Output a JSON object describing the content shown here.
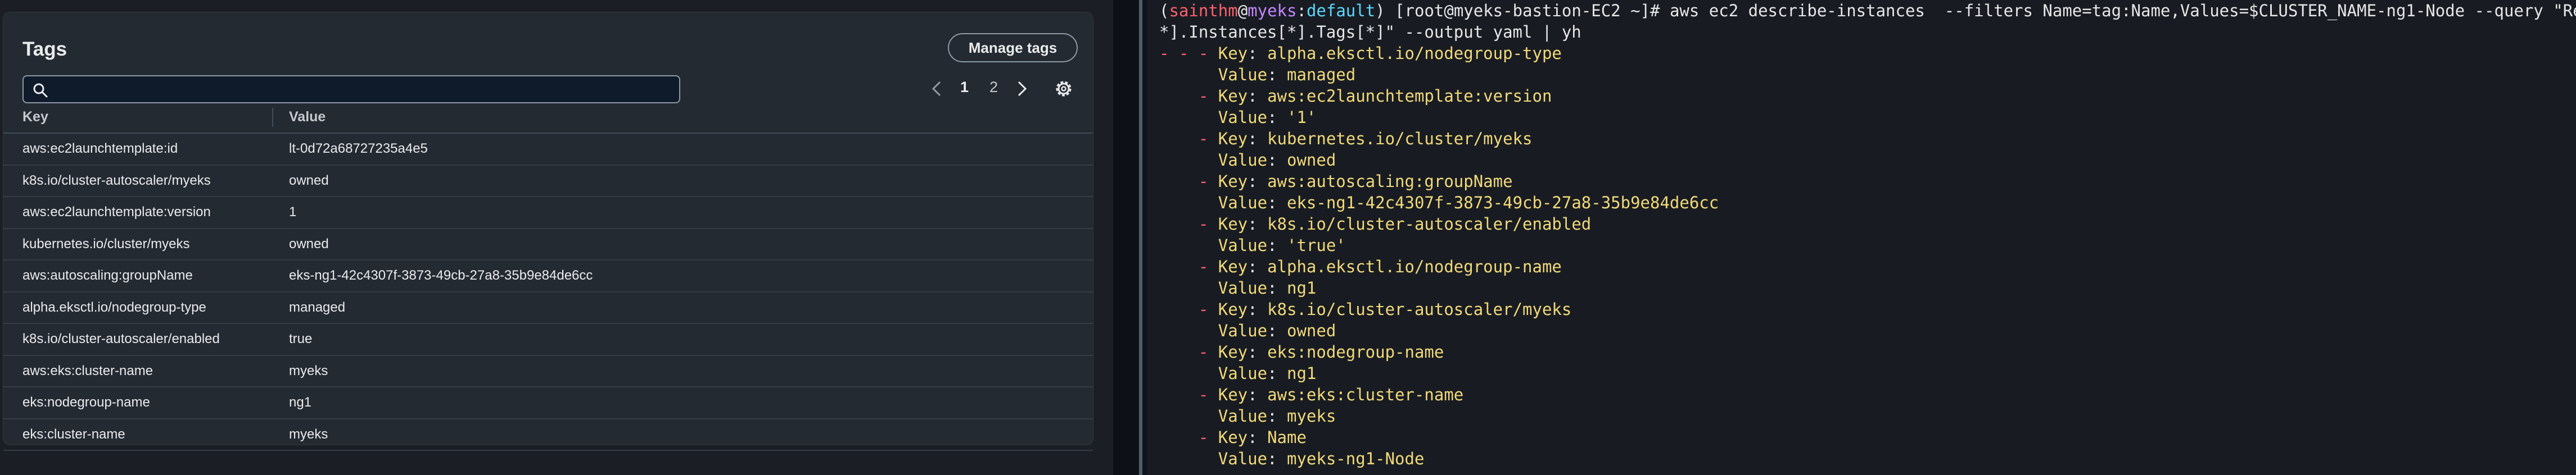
{
  "console": {
    "title": "Tags",
    "manage_button": "Manage tags",
    "search": {
      "placeholder": "",
      "value": ""
    },
    "pagination": {
      "pages": [
        "1",
        "2"
      ],
      "current": "1"
    },
    "columns": [
      "Key",
      "Value"
    ],
    "rows": [
      {
        "key": "aws:ec2launchtemplate:id",
        "value": "lt-0d72a68727235a4e5"
      },
      {
        "key": "k8s.io/cluster-autoscaler/myeks",
        "value": "owned"
      },
      {
        "key": "aws:ec2launchtemplate:version",
        "value": "1"
      },
      {
        "key": "kubernetes.io/cluster/myeks",
        "value": "owned"
      },
      {
        "key": "aws:autoscaling:groupName",
        "value": "eks-ng1-42c4307f-3873-49cb-27a8-35b9e84de6cc"
      },
      {
        "key": "alpha.eksctl.io/nodegroup-type",
        "value": "managed"
      },
      {
        "key": "k8s.io/cluster-autoscaler/enabled",
        "value": "true"
      },
      {
        "key": "aws:eks:cluster-name",
        "value": "myeks"
      },
      {
        "key": "eks:nodegroup-name",
        "value": "ng1"
      },
      {
        "key": "eks:cluster-name",
        "value": "myeks"
      }
    ],
    "icons": {
      "search": "search-icon",
      "prev": "chevron-left-icon",
      "next": "chevron-right-icon",
      "settings": "gear-icon"
    }
  },
  "terminal": {
    "prompt": {
      "open": "(",
      "user": "sainthm",
      "at": "@",
      "host": "myeks",
      "colon": ":",
      "profile": "default",
      "rest": ") [root@myeks-bastion-EC2 ~]# aws ec2 describe-instances  --filters Name=tag:Name,Values=$CLUSTER_NAME-ng1-Node --query \"Reservations["
    },
    "command_cont": "*].Instances[*].Tags[*]\" --output yaml | yh",
    "yaml_lines": [
      {
        "dash": "- - - ",
        "label": "Key",
        "text": "alpha.eksctl.io/nodegroup-type"
      },
      {
        "indent": "      ",
        "label": "Value",
        "text": "managed"
      },
      {
        "dash": "    - ",
        "label": "Key",
        "text": "aws:ec2launchtemplate:version"
      },
      {
        "indent": "      ",
        "label": "Value",
        "text": "'1'"
      },
      {
        "dash": "    - ",
        "label": "Key",
        "text": "kubernetes.io/cluster/myeks"
      },
      {
        "indent": "      ",
        "label": "Value",
        "text": "owned"
      },
      {
        "dash": "    - ",
        "label": "Key",
        "text": "aws:autoscaling:groupName"
      },
      {
        "indent": "      ",
        "label": "Value",
        "text": "eks-ng1-42c4307f-3873-49cb-27a8-35b9e84de6cc"
      },
      {
        "dash": "    - ",
        "label": "Key",
        "text": "k8s.io/cluster-autoscaler/enabled"
      },
      {
        "indent": "      ",
        "label": "Value",
        "text": "'true'"
      },
      {
        "dash": "    - ",
        "label": "Key",
        "text": "alpha.eksctl.io/nodegroup-name"
      },
      {
        "indent": "      ",
        "label": "Value",
        "text": "ng1"
      },
      {
        "dash": "    - ",
        "label": "Key",
        "text": "k8s.io/cluster-autoscaler/myeks"
      },
      {
        "indent": "      ",
        "label": "Value",
        "text": "owned"
      },
      {
        "dash": "    - ",
        "label": "Key",
        "text": "eks:nodegroup-name"
      },
      {
        "indent": "      ",
        "label": "Value",
        "text": "ng1"
      },
      {
        "dash": "    - ",
        "label": "Key",
        "text": "aws:eks:cluster-name"
      },
      {
        "indent": "      ",
        "label": "Value",
        "text": "myeks"
      },
      {
        "dash": "    - ",
        "label": "Key",
        "text": "Name"
      },
      {
        "indent": "      ",
        "label": "Value",
        "text": "myeks-ng1-Node"
      }
    ]
  }
}
